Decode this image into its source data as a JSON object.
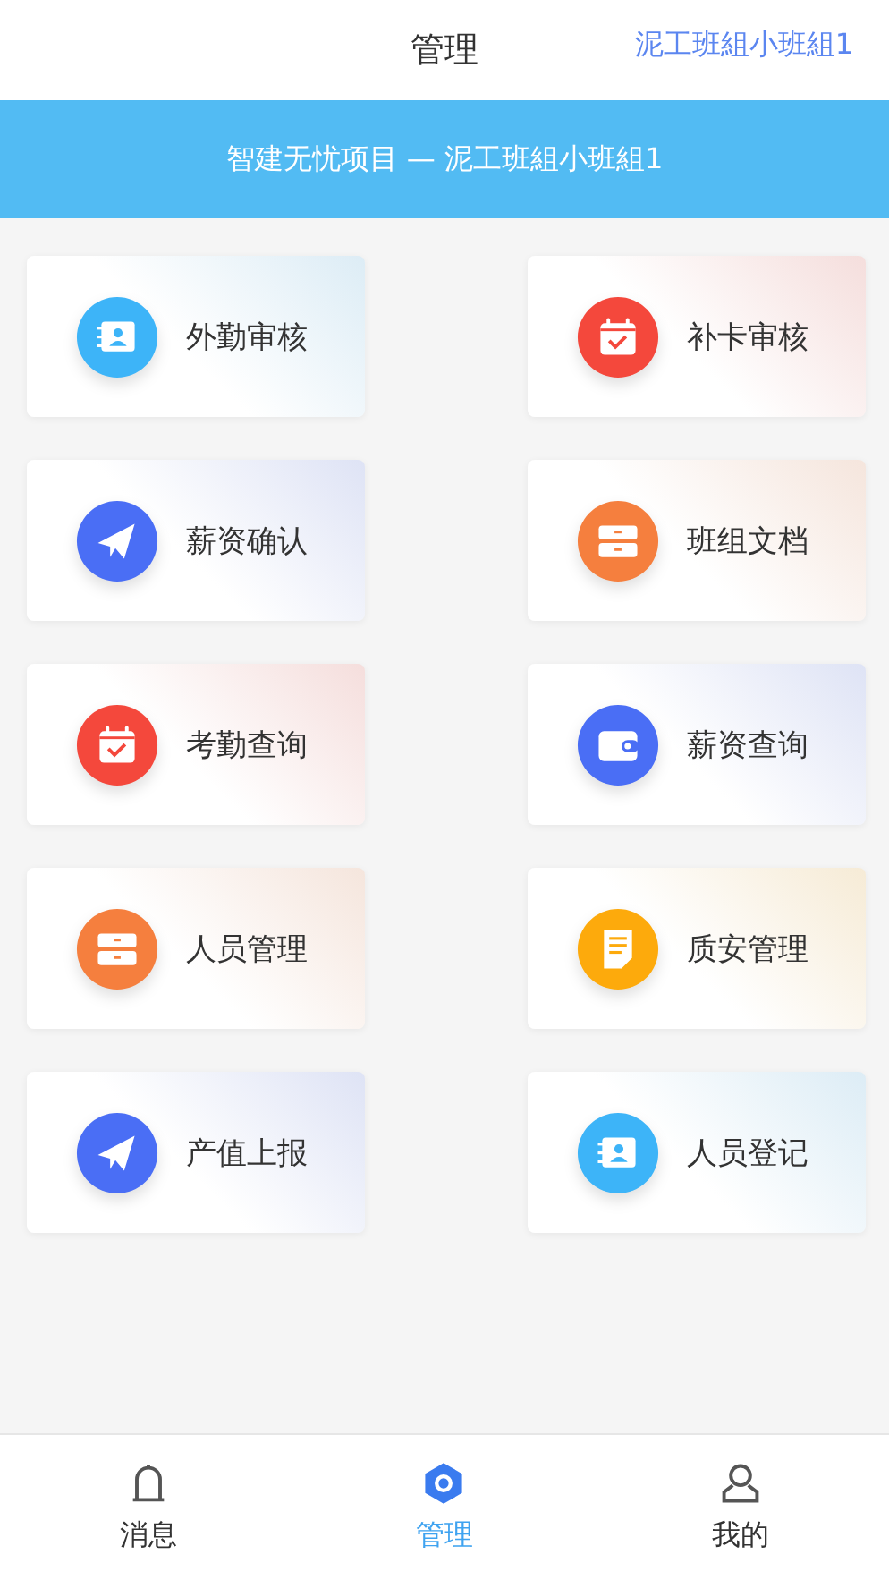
{
  "header": {
    "title": "管理",
    "team": "泥工班組小班組1"
  },
  "banner": {
    "text": "智建无忧项目 — 泥工班組小班組1"
  },
  "tiles": [
    {
      "label": "外勤审核",
      "kind": "card",
      "color": "#3db4f8"
    },
    {
      "label": "补卡审核",
      "kind": "calendar",
      "color": "#f4483c"
    },
    {
      "label": "薪资确认",
      "kind": "plane",
      "color": "#4a6ef5"
    },
    {
      "label": "班组文档",
      "kind": "drawer",
      "color": "#f57f3e"
    },
    {
      "label": "考勤查询",
      "kind": "calendar",
      "color": "#f4483c"
    },
    {
      "label": "薪资查询",
      "kind": "wallet",
      "color": "#4a6ef5"
    },
    {
      "label": "人员管理",
      "kind": "drawer",
      "color": "#f57f3e"
    },
    {
      "label": "质安管理",
      "kind": "doc",
      "color": "#fdaa0c"
    },
    {
      "label": "产值上报",
      "kind": "plane",
      "color": "#4a6ef5"
    },
    {
      "label": "人员登记",
      "kind": "card",
      "color": "#3db4f8"
    }
  ],
  "tabbar": [
    {
      "label": "消息",
      "kind": "bell",
      "selected": false
    },
    {
      "label": "管理",
      "kind": "hex",
      "selected": true
    },
    {
      "label": "我的",
      "kind": "user",
      "selected": false
    }
  ]
}
